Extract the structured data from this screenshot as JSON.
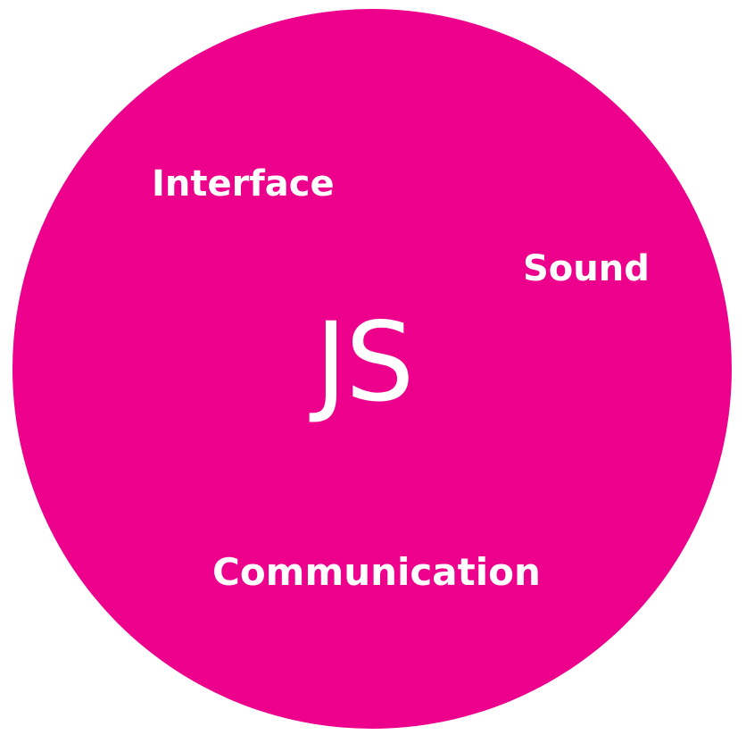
{
  "diagram": {
    "center_label": "JS",
    "labels": {
      "interface": "Interface",
      "sound": "Sound",
      "communication": "Communication"
    },
    "colors": {
      "circle_fill": "#ec008c",
      "text": "#ffffff",
      "background": "#ffffff"
    }
  }
}
